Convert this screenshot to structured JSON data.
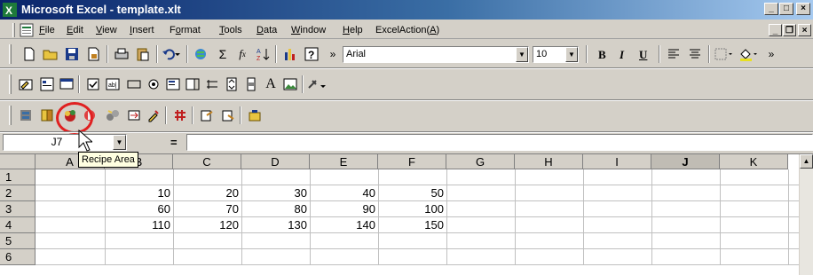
{
  "window": {
    "title": "Microsoft Excel - template.xlt",
    "controls": {
      "minimize": "_",
      "maximize": "□",
      "close": "×"
    }
  },
  "menubar": {
    "items": [
      {
        "label": "File",
        "accel": "F",
        "rest": "ile"
      },
      {
        "label": "Edit",
        "accel": "E",
        "rest": "dit"
      },
      {
        "label": "View",
        "accel": "V",
        "rest": "iew"
      },
      {
        "label": "Insert",
        "accel": "I",
        "rest": "nsert"
      },
      {
        "label": "Format",
        "pre": "F",
        "accel": "o",
        "rest": "rmat"
      },
      {
        "label": "Tools",
        "accel": "T",
        "rest": "ools"
      },
      {
        "label": "Data",
        "accel": "D",
        "rest": "ata"
      },
      {
        "label": "Window",
        "accel": "W",
        "rest": "indow"
      },
      {
        "label": "Help",
        "accel": "H",
        "rest": "elp"
      },
      {
        "label": "ExcelAction(A)",
        "pre": "ExcelAction(",
        "accel": "A",
        "rest": ")"
      }
    ],
    "doc_controls": {
      "minimize": "_",
      "restore": "❐",
      "close": "×"
    }
  },
  "toolbar_standard": {
    "font_name": "Arial",
    "font_size": "10",
    "bold": "B",
    "italic": "I",
    "underline": "U"
  },
  "toolbar_forms": {
    "label_glyph": "A"
  },
  "formula_bar": {
    "name_box": "J7",
    "equals": "=",
    "formula": ""
  },
  "sheet": {
    "columns": [
      "A",
      "B",
      "C",
      "D",
      "E",
      "F",
      "G",
      "H",
      "I",
      "J",
      "K"
    ],
    "active_column": "J",
    "rows": [
      "1",
      "2",
      "3",
      "4",
      "5",
      "6"
    ],
    "cells": {
      "row2": [
        "10",
        "20",
        "30",
        "40",
        "50"
      ],
      "row3": [
        "60",
        "70",
        "80",
        "90",
        "100"
      ],
      "row4": [
        "110",
        "120",
        "130",
        "140",
        "150"
      ]
    }
  },
  "tooltip": "Recipe Area",
  "colors": {
    "highlight_circle": "#e02020",
    "title_gradient_start": "#0a246a",
    "title_gradient_end": "#a6caf0",
    "face": "#d4d0c8"
  }
}
